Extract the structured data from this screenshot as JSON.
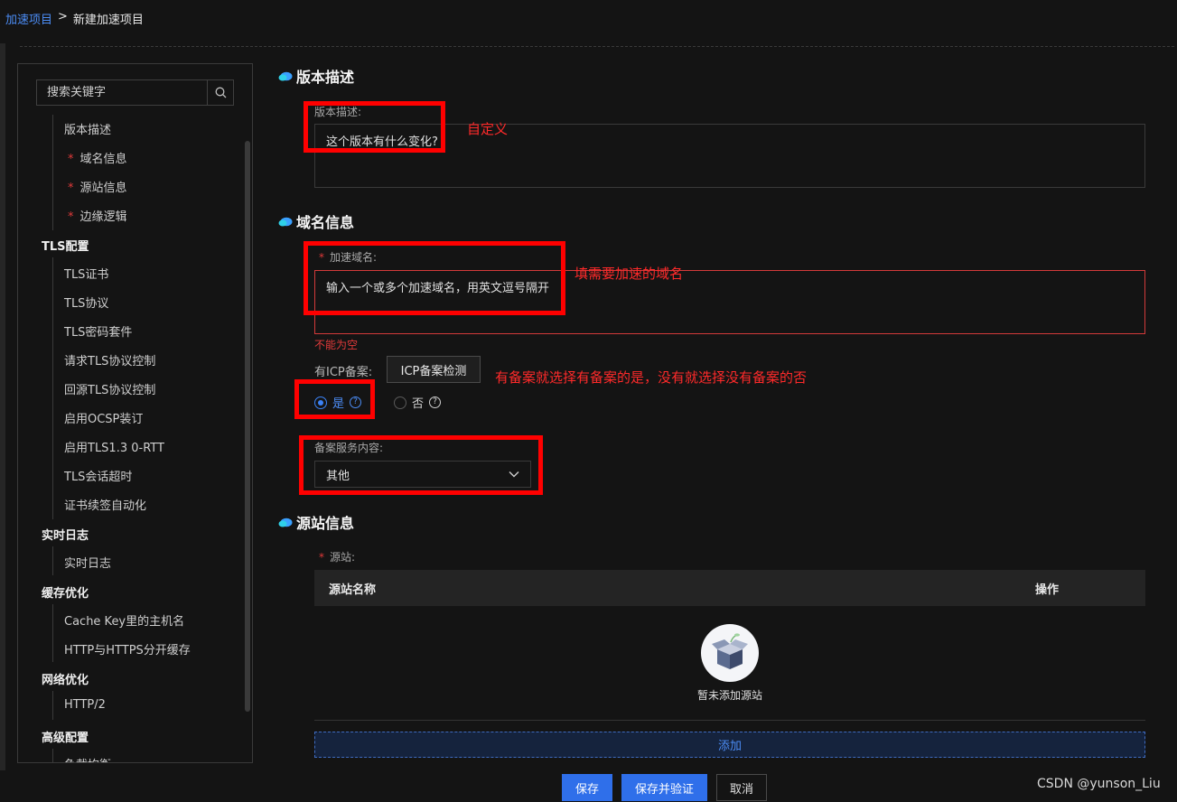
{
  "breadcrumb": {
    "parent": "加速项目",
    "separator": ">",
    "current": "新建加速项目"
  },
  "sidebar": {
    "search_placeholder": "搜索关键字",
    "items": [
      {
        "label": "版本描述",
        "required": false
      },
      {
        "label": "域名信息",
        "required": true
      },
      {
        "label": "源站信息",
        "required": true
      },
      {
        "label": "边缘逻辑",
        "required": true
      }
    ],
    "groups": [
      {
        "title": "TLS配置",
        "items": [
          "TLS证书",
          "TLS协议",
          "TLS密码套件",
          "请求TLS协议控制",
          "回源TLS协议控制",
          "启用OCSP装订",
          "启用TLS1.3 0-RTT",
          "TLS会话超时",
          "证书续签自动化"
        ]
      },
      {
        "title": "实时日志",
        "items": [
          "实时日志"
        ]
      },
      {
        "title": "缓存优化",
        "items": [
          "Cache Key里的主机名",
          "HTTP与HTTPS分开缓存"
        ]
      },
      {
        "title": "网络优化",
        "items": [
          "HTTP/2"
        ]
      },
      {
        "title": "高级配置",
        "items": [
          "负载均衡"
        ]
      }
    ]
  },
  "version": {
    "section_title": "版本描述",
    "field_label": "版本描述:",
    "placeholder": "这个版本有什么变化?"
  },
  "domain": {
    "section_title": "域名信息",
    "field_label": "加速域名:",
    "placeholder": "输入一个或多个加速域名，用英文逗号隔开",
    "error": "不能为空",
    "icp_label": "有ICP备案:",
    "icp_check_button": "ICP备案检测",
    "radio_yes": "是",
    "radio_no": "否",
    "service_label": "备案服务内容:",
    "service_value": "其他"
  },
  "origin": {
    "section_title": "源站信息",
    "field_label": "源站:",
    "columns": [
      "源站名称",
      "操作"
    ],
    "empty_text": "暂未添加源站",
    "add_button": "添加"
  },
  "footer": {
    "save": "保存",
    "save_verify": "保存并验证",
    "cancel": "取消"
  },
  "annotations": {
    "custom": "自定义",
    "domain_hint": "填需要加速的域名",
    "icp_hint": "有备案就选择有备案的是，没有就选择没有备案的否"
  },
  "watermark": "CSDN @yunson_Liu",
  "colors": {
    "accent": "#2f6fea",
    "link": "#4c8df6",
    "error": "#e03a3a",
    "annotation": "#ff0000",
    "background": "#141414"
  }
}
